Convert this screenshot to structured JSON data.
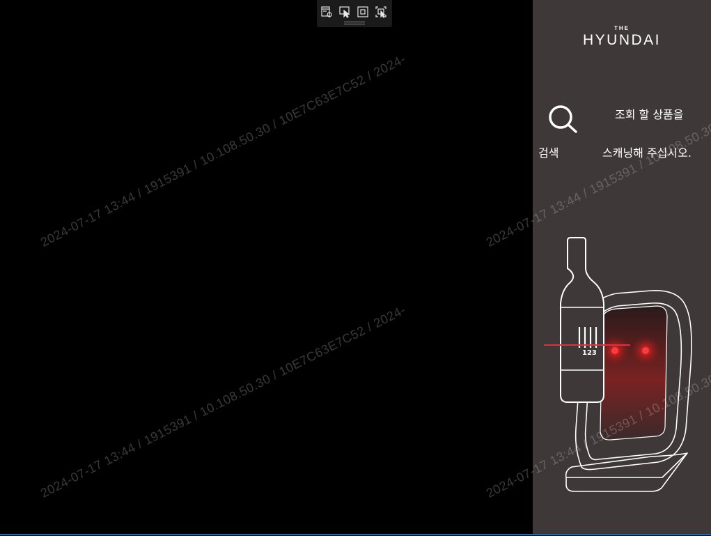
{
  "toolbar": {
    "buttons": [
      {
        "name": "settings-toolbar-icon"
      },
      {
        "name": "pointer-select-icon"
      },
      {
        "name": "frame-capture-icon"
      },
      {
        "name": "area-capture-icon"
      }
    ]
  },
  "side_panel": {
    "logo_the": "THE",
    "logo_main": "HYUNDAI",
    "search_label": "검색",
    "prompt_line1": "조회 할 상품을",
    "prompt_line2": "스캐닝해 주십시오.",
    "barcode_number": "123"
  },
  "watermark": {
    "text": "2024-07-17 13:44 / 1915391 / 10.108.50.30 / 10E7C63E7C52 / 2024-"
  },
  "colors": {
    "panel_bg": "#3e3838",
    "main_bg": "#000000",
    "scan_laser": "#e0303a"
  }
}
